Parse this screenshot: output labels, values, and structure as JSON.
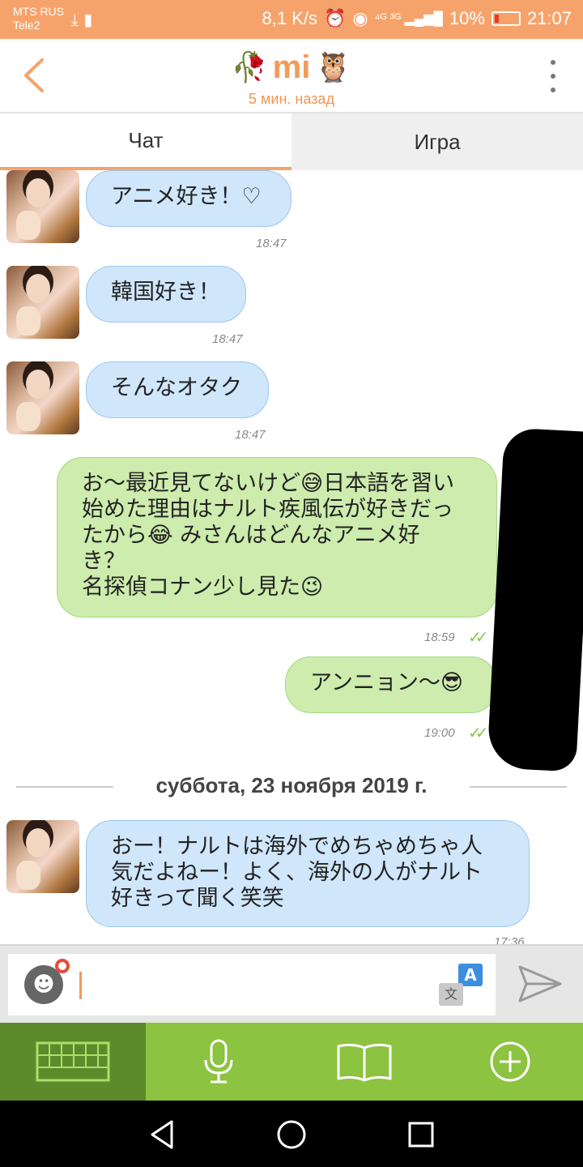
{
  "status_bar": {
    "carrier_1": "MTS RUS",
    "carrier_2": "Tele2",
    "speed": "8,1 K/s",
    "signal_labels": "⁴ᴳ ³ᴳ",
    "battery": "10%",
    "time": "21:07"
  },
  "header": {
    "contact_name": "mi",
    "last_seen": "5 мин. назад",
    "icons": [
      "back-arrow-icon",
      "rose-icon",
      "owl-icon",
      "more-vert-icon"
    ]
  },
  "tabs": [
    {
      "label": "Чат",
      "active": true
    },
    {
      "label": "Игра",
      "active": false
    }
  ],
  "messages": [
    {
      "dir": "in",
      "text": "アニメ好き！♡",
      "time": "18:47"
    },
    {
      "dir": "in",
      "text": "韓国好き！",
      "time": "18:47"
    },
    {
      "dir": "in",
      "text": "そんなオタク",
      "time": "18:47"
    },
    {
      "dir": "out",
      "text": "お〜最近見てないけど😅日本語を習い\n始めた理由はナルト疾風伝が好きだっ\nたから😂 みさんはどんなアニメ好\nき？\n名探偵コナン少し見た😉",
      "time": "18:59",
      "read": true
    },
    {
      "dir": "out",
      "text": "アンニョン〜😎",
      "time": "19:00",
      "read": true
    },
    {
      "dir": "in",
      "text": "おー！ナルトは海外でめちゃめちゃ人\n気だよねー！よく、海外の人がナルト\n好きって聞く笑笑",
      "time": "17:36"
    }
  ],
  "date_separator": "суббота, 23 ноября 2019 г.",
  "input": {
    "value": "",
    "placeholder": ""
  },
  "translate": {
    "top": "A",
    "bottom": "文"
  },
  "colors": {
    "accent": "#f6a36b",
    "incoming_bubble": "#cfe6fb",
    "outgoing_bubble": "#cdecad",
    "toolbar": "#8cc340",
    "toolbar_active": "#5d8a2a"
  },
  "toolbar": [
    "keyboard-icon",
    "microphone-icon",
    "book-icon",
    "plus-circle-icon"
  ],
  "navbar": [
    "back-triangle-icon",
    "home-circle-icon",
    "recents-square-icon"
  ]
}
